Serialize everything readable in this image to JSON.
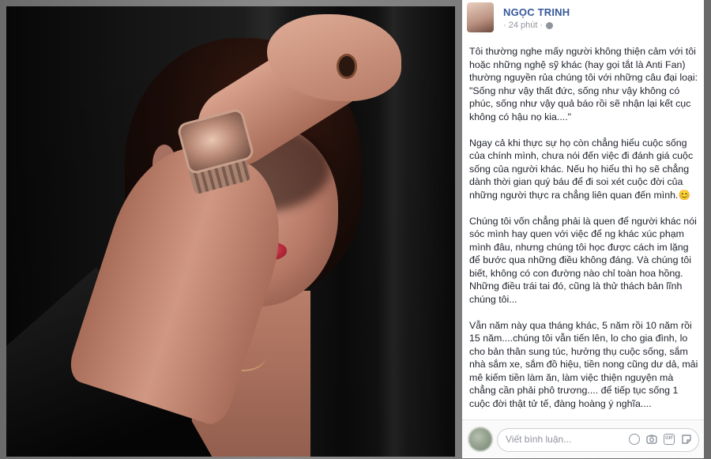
{
  "post": {
    "author_name": "NGỌC TRINH",
    "time": "· 24 phút ·",
    "body": "Tôi thường nghe mấy người không thiện cảm với tôi hoặc những nghệ sỹ khác (hay gọi tắt là Anti Fan) thường nguyền rủa chúng tôi với những câu đại loại:\n\"Sống như vậy thất đức, sống như vậy không có phúc, sống như vậy quả báo rồi sẽ nhận lại kết cục không có hậu nọ kia....\"\n\nNgay cả khi thực sự họ còn chẳng hiểu cuộc sống của chính mình, chưa nói đến việc đi đánh giá cuộc sống của người khác. Nếu họ hiểu thì họ sẽ chẳng dành thời gian quý báu để đi soi xét cuộc đời của những người thực ra chẳng liên quan đến mình.😊\n\nChúng tôi vốn chẳng phải là quen để người khác nói sóc mình hay quen với việc để ng khác xúc phạm mình đâu, nhưng chúng tôi học được cách im lặng để bước qua những điều không đáng. Và chúng tôi biết, không có con đường nào chỉ toàn hoa hồng. Những điều trái tai đó, cũng là thử thách bản lĩnh chúng tôi...\n\nVẫn năm này qua tháng khác, 5 năm rồi 10 năm rồi 15 năm....chúng tôi vẫn tiến lên, lo cho gia đình, lo cho bản thân sung túc, hưởng thụ cuộc sống, sắm nhà sắm xe, sắm đồ hiệu, tiền nong cũng dư dả, mải mê kiếm tiền làm ăn, làm việc thiện nguyện mà chẳng cần phải phô trương.... để tiếp tục sống 1 cuộc đời thật tử tế, đàng hoàng ý nghĩa...."
  },
  "comment": {
    "placeholder": "Viết bình luận...",
    "icons": [
      "emoji-icon",
      "camera-icon",
      "gif-icon",
      "sticker-icon"
    ]
  }
}
